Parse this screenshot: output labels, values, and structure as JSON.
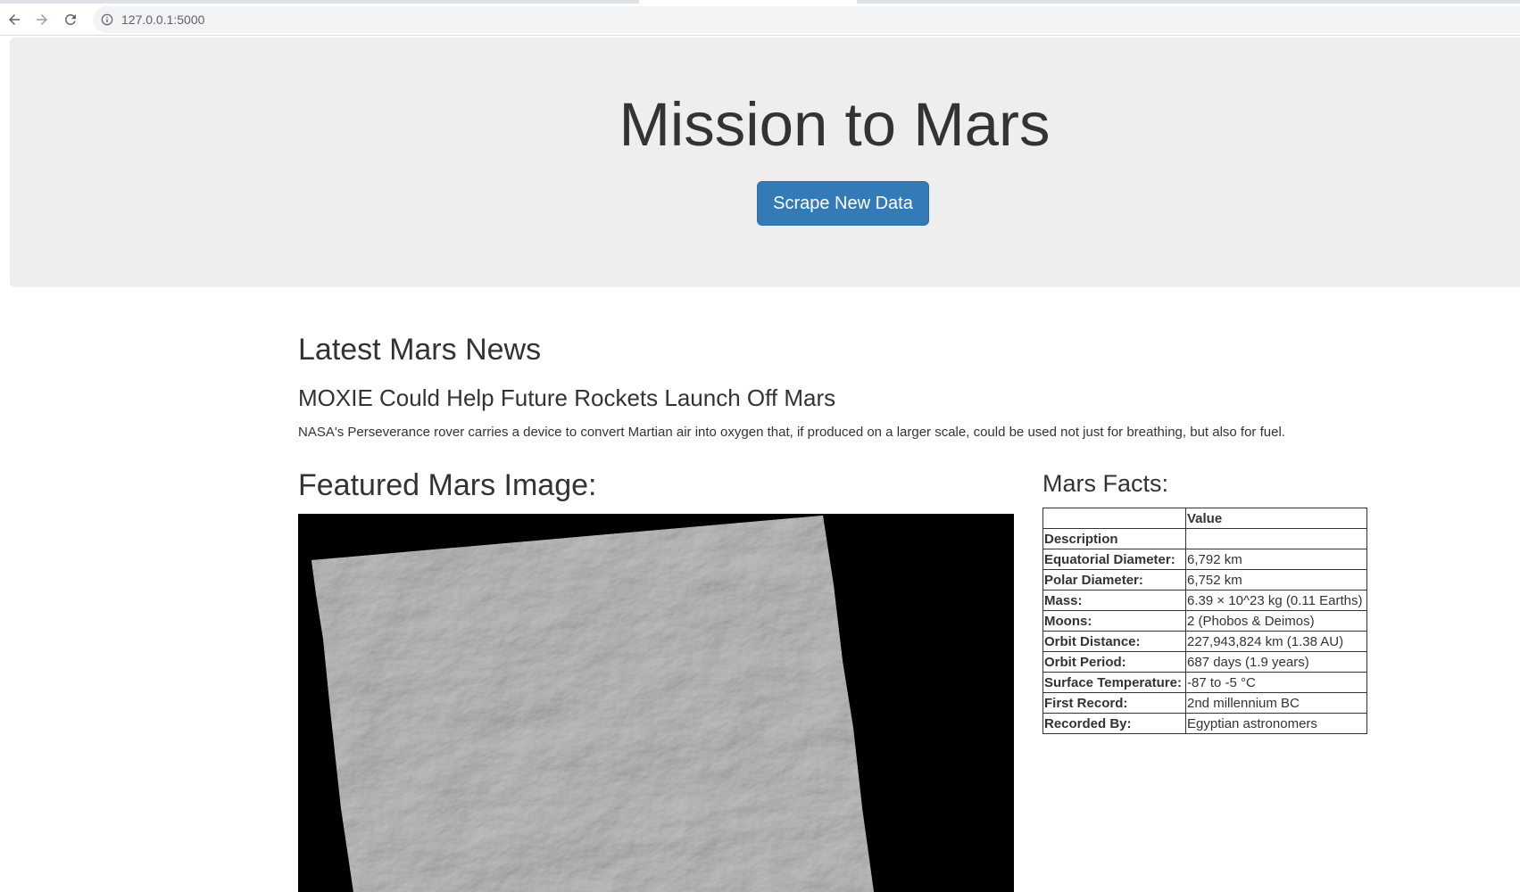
{
  "browser": {
    "url": "127.0.0.1:5000"
  },
  "jumbotron": {
    "title": "Mission to Mars",
    "button_label": "Scrape New Data",
    "button_color": "#337ab7"
  },
  "news": {
    "heading": "Latest Mars News",
    "title": "MOXIE Could Help Future Rockets Launch Off Mars",
    "paragraph": "NASA's Perseverance rover carries a device to convert Martian air into oxygen that, if produced on a larger scale, could be used not just for breathing, but also for fuel."
  },
  "featured_image": {
    "heading": "Featured Mars Image:"
  },
  "facts": {
    "heading": "Mars Facts:",
    "header": [
      "",
      "Value"
    ],
    "rows": [
      {
        "label": "Description",
        "value": ""
      },
      {
        "label": "Equatorial Diameter:",
        "value": "6,792 km"
      },
      {
        "label": "Polar Diameter:",
        "value": "6,752 km"
      },
      {
        "label": "Mass:",
        "value": "6.39 × 10^23 kg (0.11 Earths)"
      },
      {
        "label": "Moons:",
        "value": "2 (Phobos & Deimos)"
      },
      {
        "label": "Orbit Distance:",
        "value": "227,943,824 km (1.38 AU)"
      },
      {
        "label": "Orbit Period:",
        "value": "687 days (1.9 years)"
      },
      {
        "label": "Surface Temperature:",
        "value": "-87 to -5 °C"
      },
      {
        "label": "First Record:",
        "value": "2nd millennium BC"
      },
      {
        "label": "Recorded By:",
        "value": "Egyptian astronomers"
      }
    ]
  }
}
